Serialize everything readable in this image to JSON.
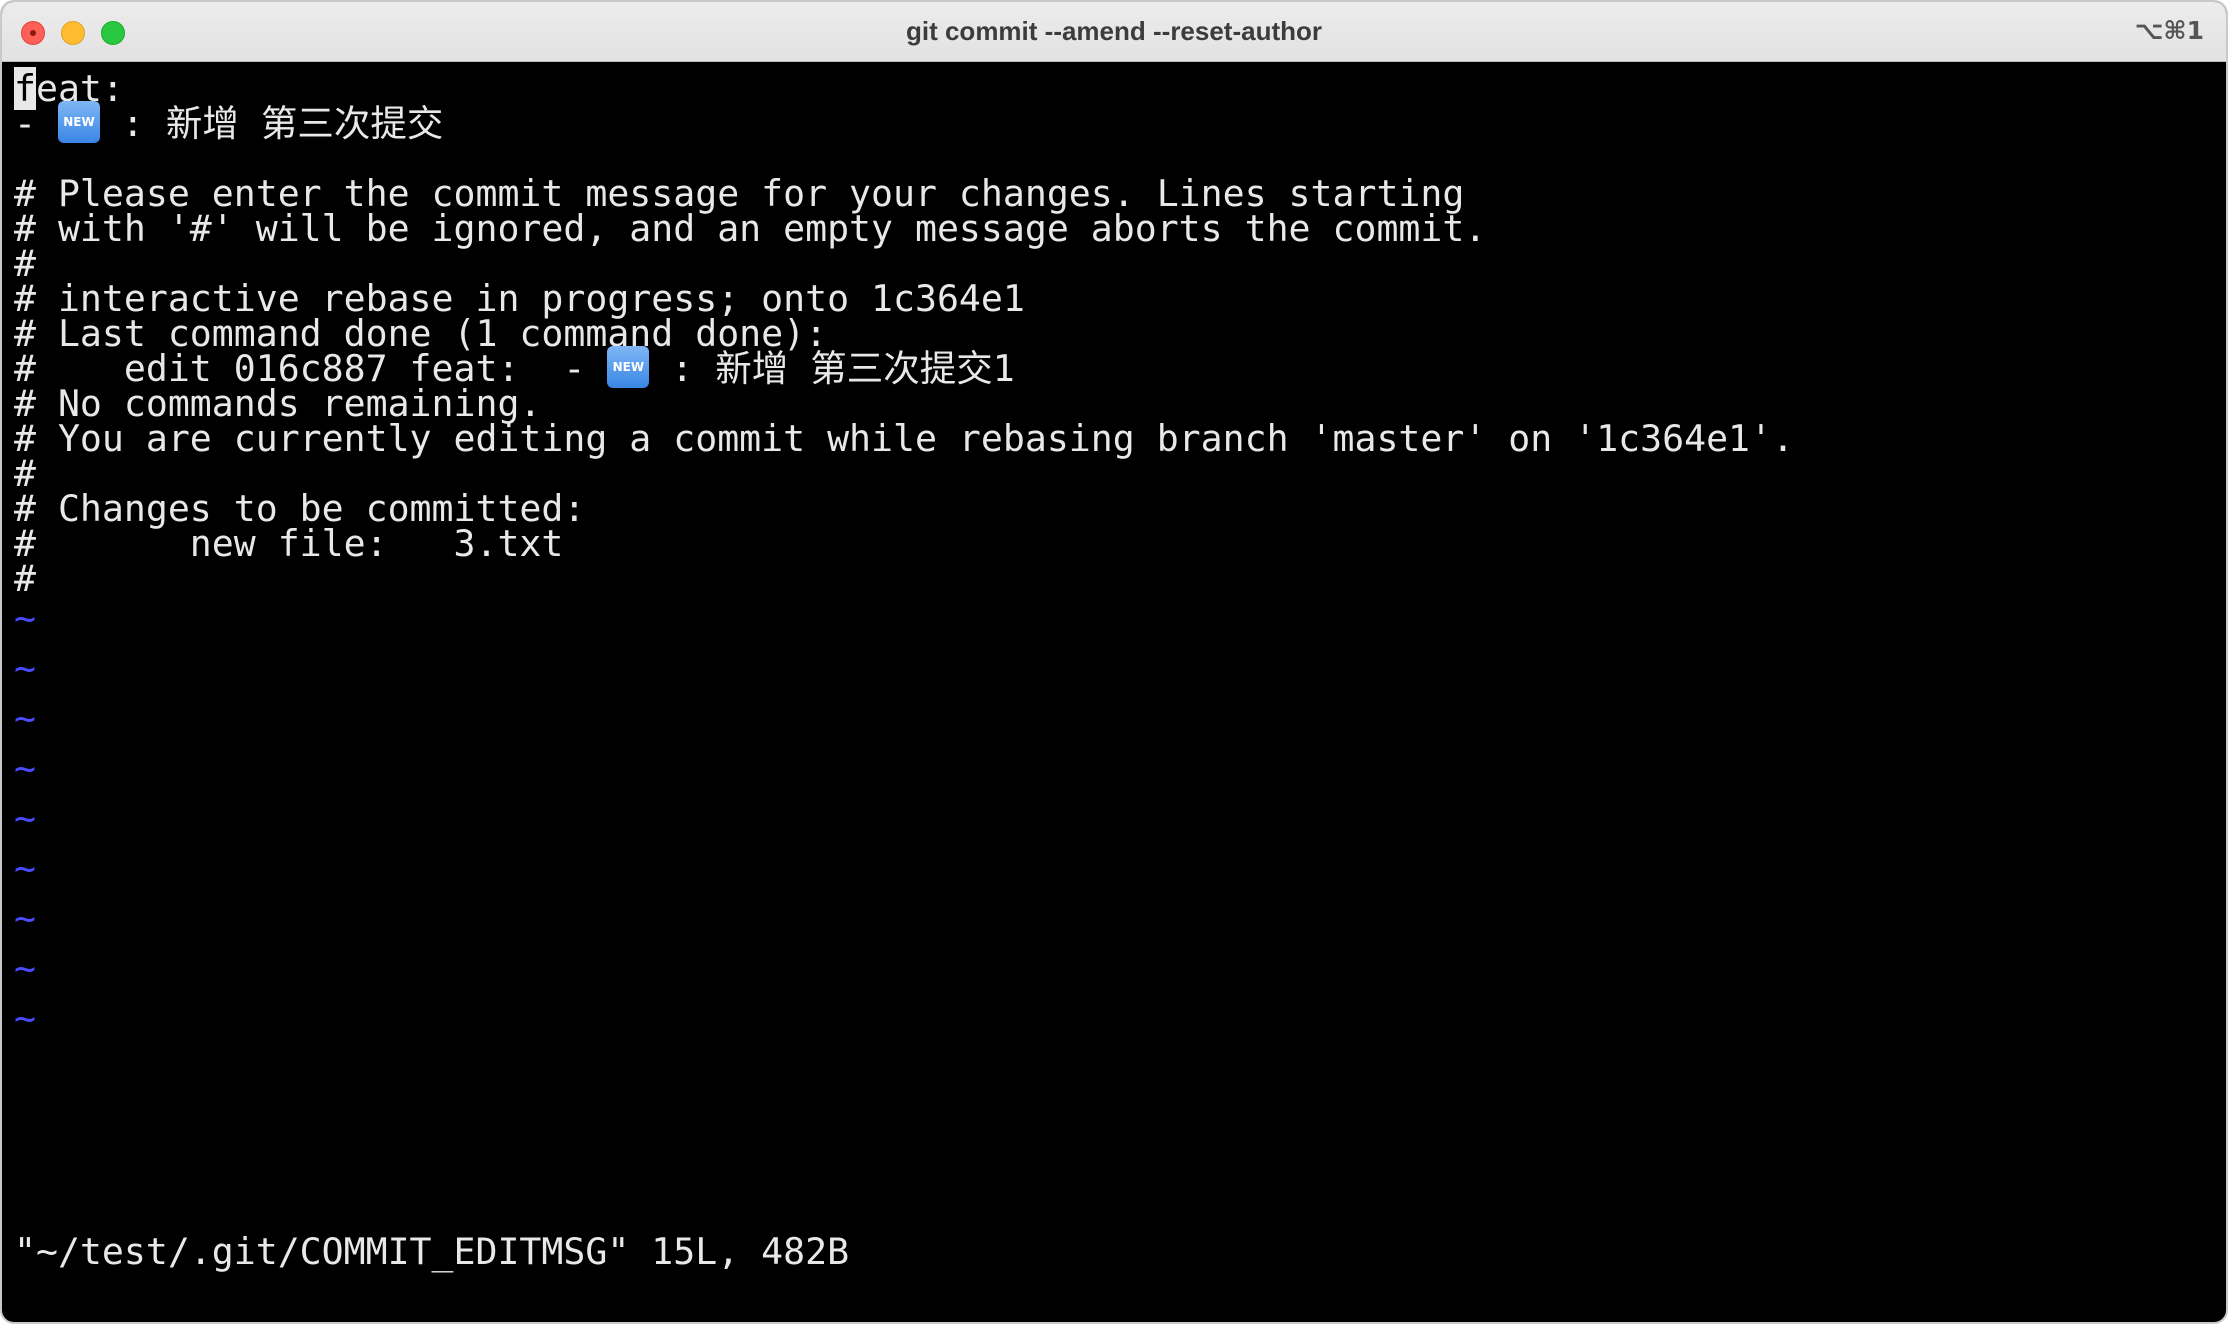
{
  "window": {
    "title": "git commit --amend --reset-author",
    "shortcut": "⌥⌘1"
  },
  "editor": {
    "cursor_char": "f",
    "line1_rest": "eat:",
    "line2_prefix": "- ",
    "line2_icon_label": "NEW",
    "line2_suffix": " : 新增 第三次提交",
    "line3": "",
    "line4": "# Please enter the commit message for your changes. Lines starting",
    "line5": "# with '#' will be ignored, and an empty message aborts the commit.",
    "line6": "#",
    "line7": "# interactive rebase in progress; onto 1c364e1",
    "line8": "# Last command done (1 command done):",
    "line9_prefix": "#    edit 016c887 feat:  - ",
    "line9_icon_label": "NEW",
    "line9_suffix": " : 新增 第三次提交1",
    "line10": "# No commands remaining.",
    "line11": "# You are currently editing a commit while rebasing branch 'master' on '1c364e1'.",
    "line12": "#",
    "line13": "# Changes to be committed:",
    "line14": "#       new file:   3.txt",
    "line15": "#",
    "tilde": "~",
    "status": "\"~/test/.git/COMMIT_EDITMSG\" 15L, 482B"
  },
  "colors": {
    "background": "#000000",
    "text": "#e8e8e8",
    "tilde": "#4a4dff"
  }
}
